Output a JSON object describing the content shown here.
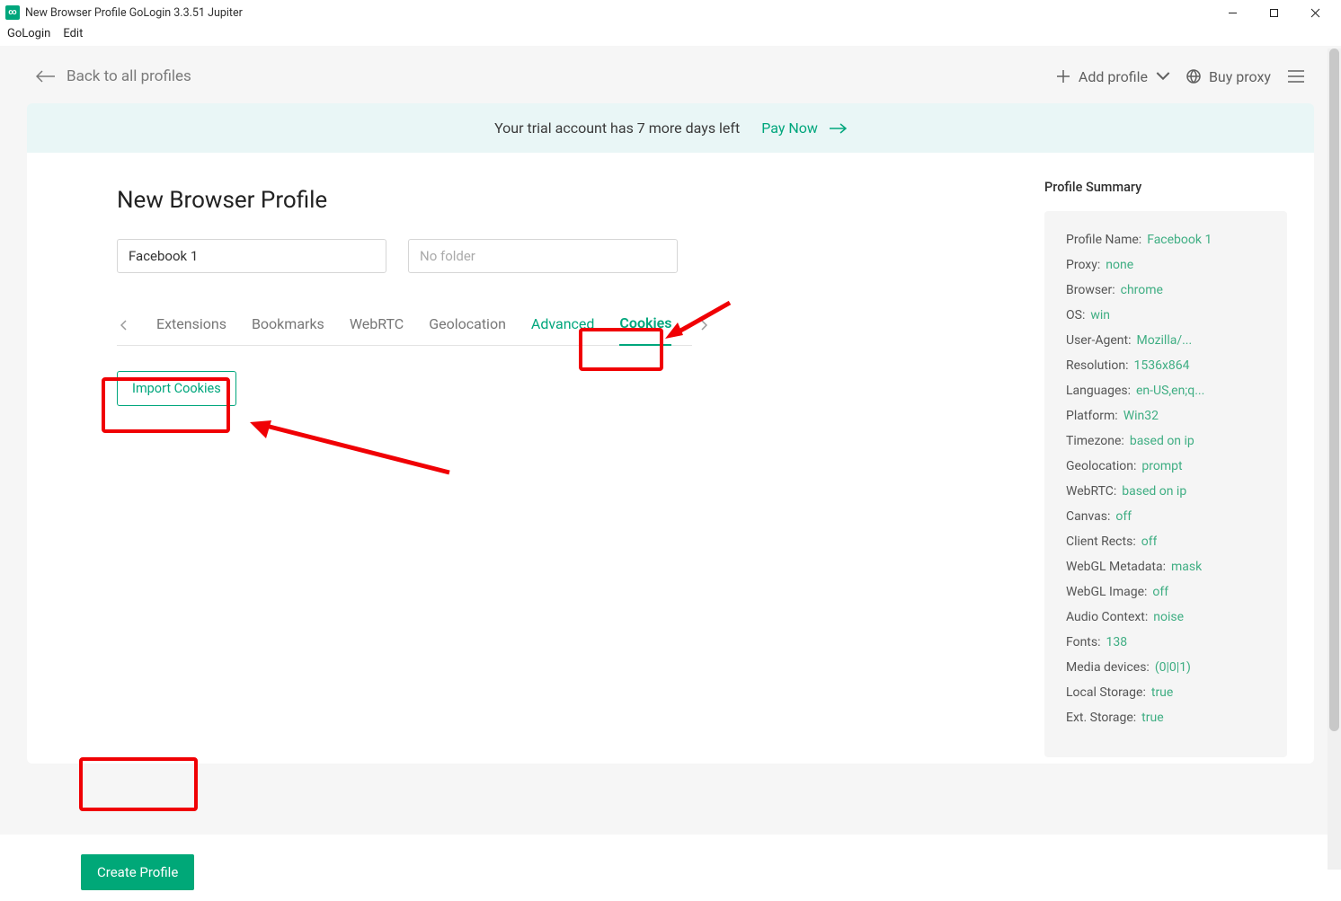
{
  "window": {
    "title": "New Browser Profile GoLogin 3.3.51 Jupiter"
  },
  "menubar": {
    "items": [
      "GoLogin",
      "Edit"
    ]
  },
  "toolbar": {
    "back_label": "Back to all profiles",
    "add_profile": "Add profile",
    "buy_proxy": "Buy proxy"
  },
  "banner": {
    "trial_text": "Your trial account has 7 more days left",
    "pay_label": "Pay Now"
  },
  "form": {
    "page_title": "New Browser Profile",
    "profile_name_value": "Facebook 1",
    "folder_placeholder": "No folder",
    "tabs": {
      "extensions": "Extensions",
      "bookmarks": "Bookmarks",
      "webrtc": "WebRTC",
      "geolocation": "Geolocation",
      "advanced": "Advanced",
      "cookies": "Cookies"
    },
    "import_cookies_label": "Import Cookies"
  },
  "summary": {
    "title": "Profile Summary",
    "rows": {
      "profile_name": {
        "k": "Profile Name:",
        "v": "Facebook 1"
      },
      "proxy": {
        "k": "Proxy:",
        "v": "none"
      },
      "browser": {
        "k": "Browser:",
        "v": "chrome"
      },
      "os": {
        "k": "OS:",
        "v": "win"
      },
      "ua": {
        "k": "User-Agent:",
        "v": "Mozilla/..."
      },
      "resolution": {
        "k": "Resolution:",
        "v": "1536x864"
      },
      "languages": {
        "k": "Languages:",
        "v": "en-US,en;q..."
      },
      "platform": {
        "k": "Platform:",
        "v": "Win32"
      },
      "timezone": {
        "k": "Timezone:",
        "v": "based on ip"
      },
      "geolocation": {
        "k": "Geolocation:",
        "v": "prompt"
      },
      "webrtc": {
        "k": "WebRTC:",
        "v": "based on ip"
      },
      "canvas": {
        "k": "Canvas:",
        "v": "off"
      },
      "client_rects": {
        "k": "Client Rects:",
        "v": "off"
      },
      "webgl_meta": {
        "k": "WebGL Metadata:",
        "v": "mask"
      },
      "webgl_img": {
        "k": "WebGL Image:",
        "v": "off"
      },
      "audio": {
        "k": "Audio Context:",
        "v": "noise"
      },
      "fonts": {
        "k": "Fonts:",
        "v": "138"
      },
      "media": {
        "k": "Media devices:",
        "v": "(0|0|1)"
      },
      "local_storage": {
        "k": "Local Storage:",
        "v": "true"
      },
      "ext_storage": {
        "k": "Ext. Storage:",
        "v": "true"
      }
    }
  },
  "footer": {
    "create_profile": "Create Profile"
  }
}
